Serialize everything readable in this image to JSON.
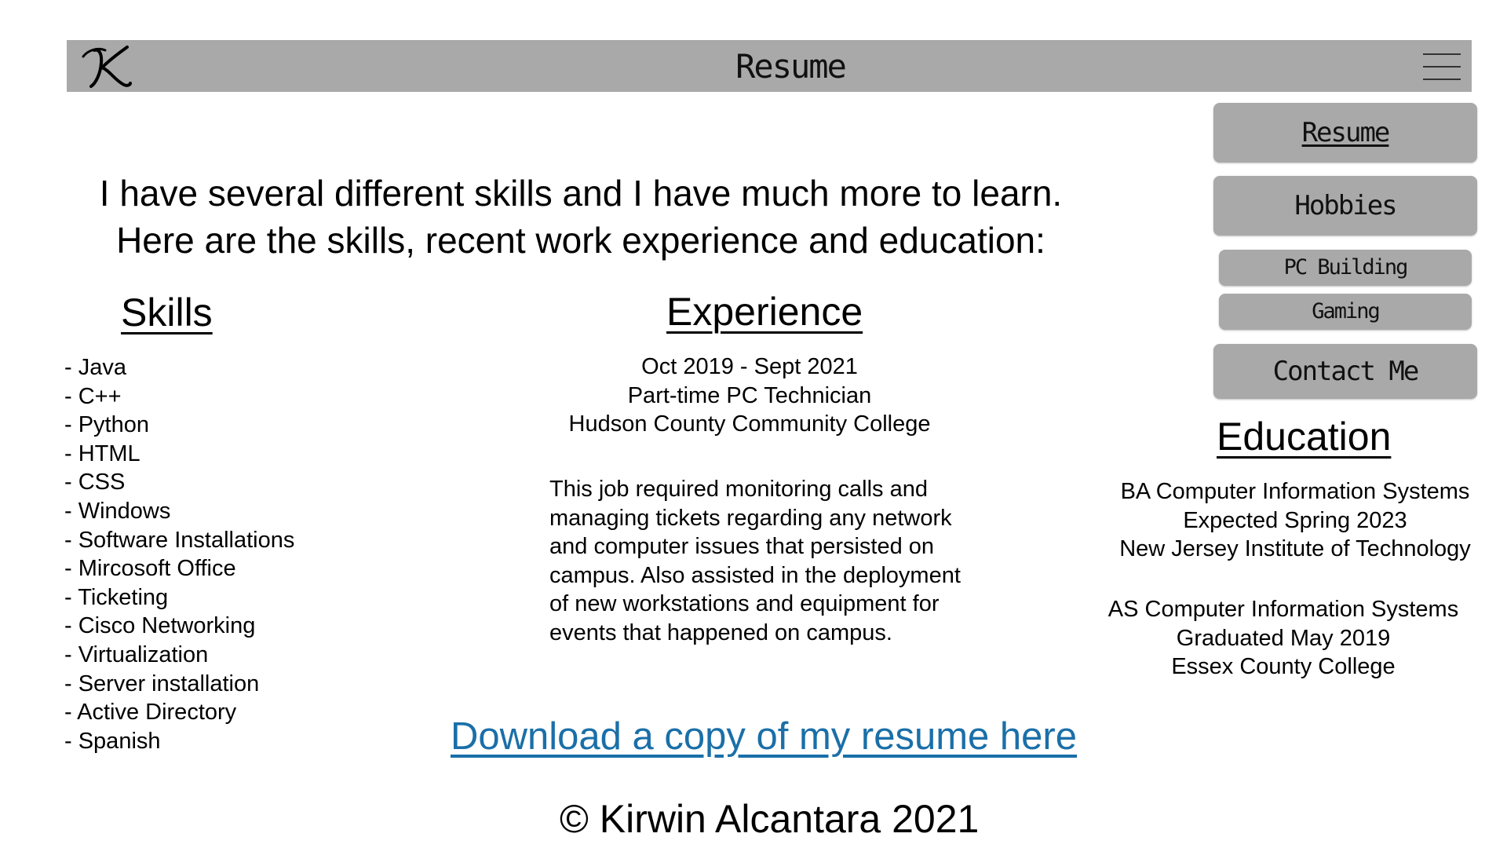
{
  "header": {
    "logo_letter": "K",
    "title": "Resume",
    "menu_icon": "hamburger-menu-icon"
  },
  "nav": {
    "items": [
      {
        "label": "Resume",
        "active": true
      },
      {
        "label": "Hobbies"
      },
      {
        "label": "PC Building"
      },
      {
        "label": "Gaming"
      },
      {
        "label": "Contact Me"
      }
    ]
  },
  "intro": {
    "line1": "I have several different skills and I have much more to learn.",
    "line2": "Here are the skills, recent work experience and education:"
  },
  "skills": {
    "title": "Skills",
    "items": [
      "- Java",
      "- C++",
      "- Python",
      "- HTML",
      "- CSS",
      "- Windows",
      "- Software Installations",
      "- Mircosoft Office",
      "- Ticketing",
      "- Cisco Networking",
      "- Virtualization",
      "- Server installation",
      "- Active Directory",
      "- Spanish"
    ]
  },
  "experience": {
    "title": "Experience",
    "dates": "Oct 2019 - Sept 2021",
    "role": "Part-time PC Technician",
    "employer": "Hudson County Community College",
    "description": [
      "This job required monitoring calls and",
      "managing tickets regarding any network",
      "and computer issues that persisted on",
      "campus. Also assisted in the deployment",
      "of new workstations and equipment for",
      "events that happened on campus."
    ]
  },
  "education": {
    "title": "Education",
    "entries": [
      {
        "degree": "BA Computer Information Systems",
        "status": "Expected Spring 2023",
        "school": "New Jersey Institute of Technology"
      },
      {
        "degree": "AS Computer Information Systems",
        "status": "Graduated May 2019",
        "school": "Essex County College"
      }
    ]
  },
  "download": {
    "label": "Download a copy of my resume here"
  },
  "footer": {
    "text": "© Kirwin Alcantara 2021"
  },
  "colors": {
    "bar": "#a9a9a9",
    "link": "#1a6fa8"
  }
}
